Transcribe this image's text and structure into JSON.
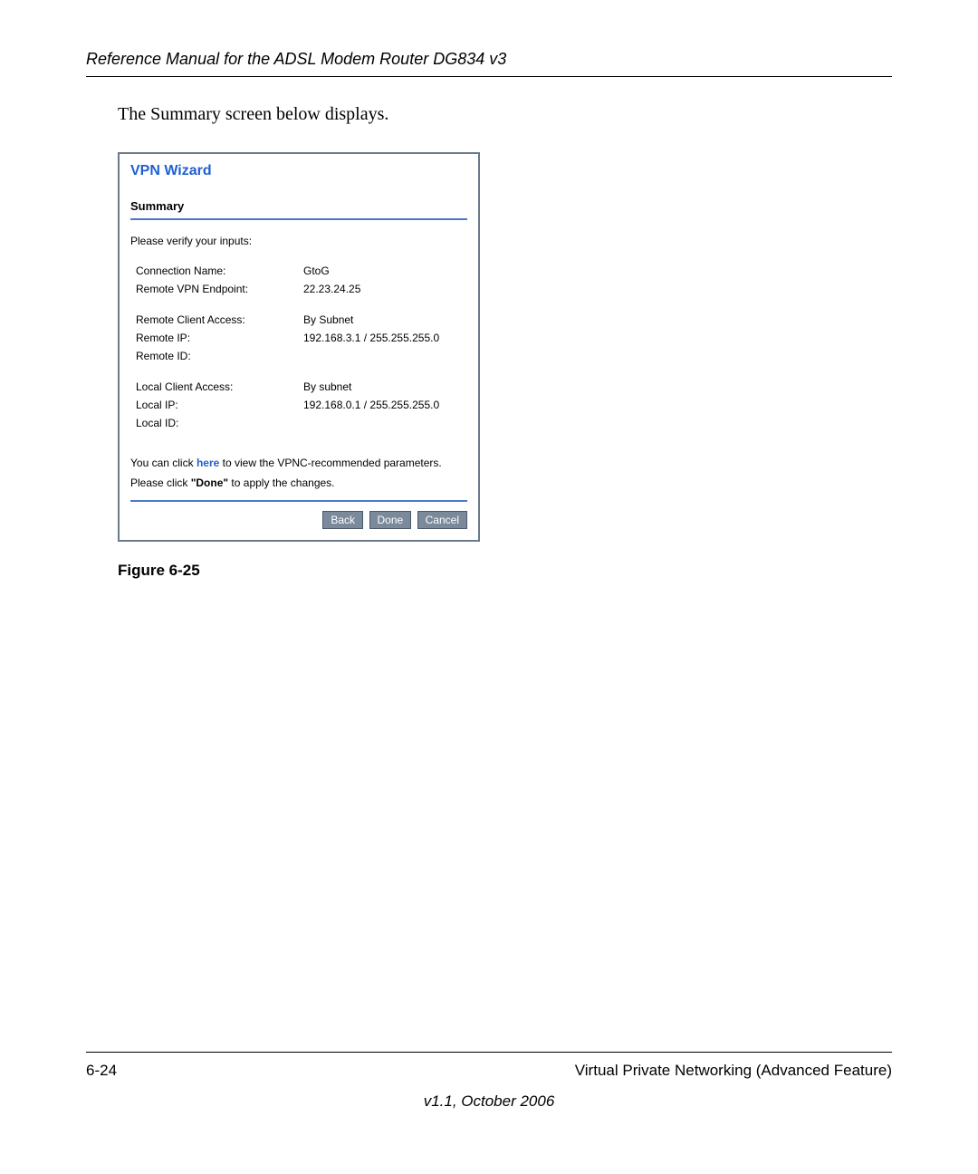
{
  "header": {
    "title": "Reference Manual for the ADSL Modem Router DG834 v3"
  },
  "intro": "The Summary screen below displays.",
  "wizard": {
    "title": "VPN Wizard",
    "summary_heading": "Summary",
    "verify_text": "Please verify your inputs:",
    "group1": [
      {
        "label": "Connection Name:",
        "value": "GtoG"
      },
      {
        "label": "Remote VPN Endpoint:",
        "value": "22.23.24.25"
      }
    ],
    "group2": [
      {
        "label": "Remote Client Access:",
        "value": "By Subnet"
      },
      {
        "label": "Remote IP:",
        "value": "192.168.3.1 / 255.255.255.0"
      },
      {
        "label": "Remote ID:",
        "value": ""
      }
    ],
    "group3": [
      {
        "label": "Local Client Access:",
        "value": "By subnet"
      },
      {
        "label": "Local IP:",
        "value": "192.168.0.1 / 255.255.255.0"
      },
      {
        "label": "Local ID:",
        "value": ""
      }
    ],
    "footer_note": {
      "prefix": "You can click ",
      "link": "here",
      "suffix": " to view the VPNC-recommended parameters."
    },
    "apply_note": {
      "prefix": "Please click ",
      "bold": "\"Done\"",
      "suffix": " to apply the changes."
    },
    "buttons": {
      "back": "Back",
      "done": "Done",
      "cancel": "Cancel"
    }
  },
  "figure_caption": "Figure 6-25",
  "footer": {
    "page_num": "6-24",
    "section": "Virtual Private Networking (Advanced Feature)",
    "version": "v1.1, October 2006"
  }
}
